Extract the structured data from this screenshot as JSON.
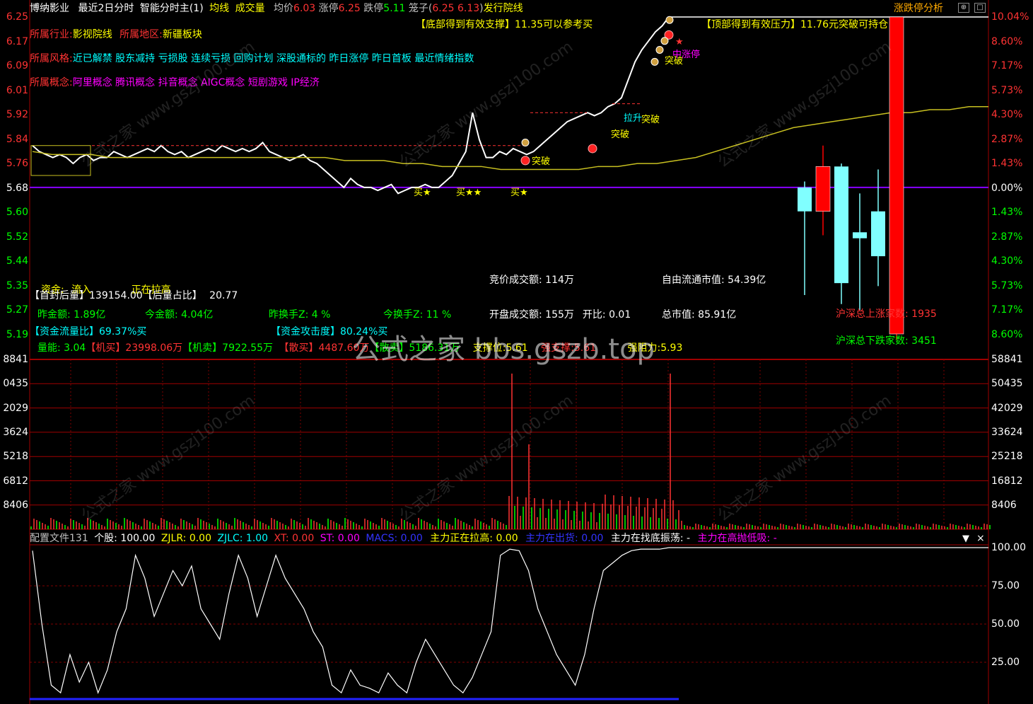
{
  "header": {
    "stock_name": "博纳影业",
    "mode": "最近2日分时",
    "indicator": "智能分时主(1)",
    "avg_line_label": "均线",
    "volume_label": "成交量",
    "avg_price_label": "均价",
    "avg_price": "6.03",
    "limit_up_label": "涨停",
    "limit_up": "6.25",
    "limit_down_label": "跌停",
    "limit_down": "5.11",
    "cage_label": "笼子(",
    "cage_value": "6.25 6.13",
    "cage_close": ")",
    "industry_tag": "发行院线",
    "button_label": "涨跌停分析"
  },
  "info": {
    "industry_label": "所属行业:",
    "industry": "影视院线",
    "region_label": "所属地区:",
    "region": "新疆板块",
    "style_label": "所属风格:",
    "style": "近已解禁 股东减持 亏损股 连续亏损 回购计划 深股通标的 昨日涨停 昨日首板 最近情绪指数",
    "concept_label": "所属概念:",
    "concept": "阿里概念 腾讯概念 抖音概念 AIGC概念 短剧游戏 IP经济",
    "support_label": "【底部得到有效支撑】",
    "support_text": "11.35可以参考买",
    "resist_label": "【顶部得到有效压力】",
    "resist_text": "11.76元突破可持仓"
  },
  "annotations": {
    "buy": "买",
    "star": "★",
    "breakout": "突破",
    "pull_up": "拉升",
    "mid_limit": "中涨停",
    "flag": "$",
    "arrow": "↑"
  },
  "stats": {
    "fund_label": "资金:",
    "fund_value": "流入",
    "pulling_label": "正在拉高",
    "first_seal_label": "【首封后量】",
    "first_seal_value": "139154.00",
    "after_ratio_label": "【后量占比】",
    "after_ratio_value": "20.77",
    "yday_amount_label": "昨金额:",
    "yday_amount": "1.89亿",
    "today_amount_label": "今金额:",
    "today_amount": "4.04亿",
    "yday_turnover_label": "昨换手Z:",
    "yday_turnover": "4 %",
    "today_turnover_label": "今换手Z:",
    "today_turnover": "11 %",
    "flow_ratio_label": "【资金流量比】",
    "flow_ratio": "69.37",
    "flow_ratio_unit": "%买",
    "attack_label": "【资金攻击度】",
    "attack": "80.24",
    "attack_unit": "%买",
    "vol_energy_label": "量能:",
    "vol_energy": "3.04",
    "inst_buy_label": "【机买】",
    "inst_buy": "23998.06万",
    "inst_sell_label": "【机卖】",
    "inst_sell": "7922.55万",
    "retail_buy_label": "【散买】",
    "retail_buy": "4487.60万",
    "retail_sell_label": "【散卖】",
    "retail_sell": "5186.31万",
    "support_level_label": "支撑位:",
    "support_level": "5.61",
    "strong_support_label": "强支撑:",
    "strong_support": "5.61",
    "strong_resist_label": "强阻力:",
    "strong_resist": "5.93",
    "auction_amount_label": "竞价成交额:",
    "auction_amount": "114万",
    "open_amount_label": "开盘成交额:",
    "open_amount": "155万",
    "open_ratio_label": "开比:",
    "open_ratio": "0.01",
    "float_cap_label": "自由流通市值:",
    "float_cap": "54.39亿",
    "total_cap_label": "总市值:",
    "total_cap": "85.91亿",
    "market_up_label": "沪深总上涨家数:",
    "market_up": "1935",
    "market_down_label": "沪深总下跌家数:",
    "market_down": "3451"
  },
  "watermark": {
    "center": "公式之家 bbs.gszb.top",
    "tile": "公式之家 www.gszj100.com"
  },
  "lower_panel": {
    "config_label": "配置文件131",
    "stock_label": "个股:",
    "stock_value": "100.00",
    "zjlr_label": "ZJLR:",
    "zjlr": "0.00",
    "zjlc_label": "ZJLC:",
    "zjlc": "1.00",
    "xt_label": "XT:",
    "xt": "0.00",
    "st_label": "ST:",
    "st": "0.00",
    "macs_label": "MACS:",
    "macs": "0.00",
    "main_pull_label": "主力正在拉高:",
    "main_pull": "0.00",
    "main_out_label": "主力在出货:",
    "main_out": "0.00",
    "main_bottom_label": "主力在找底振荡:",
    "main_bottom": "-",
    "main_high_label": "主力在高抛低吸:",
    "main_high": "-",
    "dropdown_icon": "▼",
    "close_icon": "×"
  },
  "colors": {
    "up": "#ff3333",
    "down": "#00ff00",
    "price_line": "#ffffff",
    "avg_line": "#c8c020",
    "prev_close": "#8800ff",
    "candle_up": "#ff0000",
    "candle_down": "#80ffff",
    "grid": "#a00000"
  },
  "chart_data": [
    {
      "type": "line",
      "name": "intraday price",
      "y_left_ticks": [
        "6.25",
        "6.17",
        "6.09",
        "6.01",
        "5.92",
        "5.84",
        "5.76",
        "5.68",
        "5.60",
        "5.52",
        "5.44",
        "5.35",
        "5.27",
        "5.19"
      ],
      "y_right_ticks": [
        "10.04%",
        "8.60%",
        "7.17%",
        "5.73%",
        "4.30%",
        "2.87%",
        "1.43%",
        "0.00%",
        "1.43%",
        "2.87%",
        "4.30%",
        "5.73%",
        "7.17%",
        "8.60%"
      ],
      "prev_close": 5.68,
      "series": [
        {
          "name": "price",
          "values": [
            5.82,
            5.8,
            5.79,
            5.78,
            5.79,
            5.78,
            5.76,
            5.78,
            5.79,
            5.77,
            5.78,
            5.78,
            5.8,
            5.79,
            5.78,
            5.79,
            5.8,
            5.81,
            5.8,
            5.82,
            5.8,
            5.79,
            5.8,
            5.78,
            5.79,
            5.8,
            5.81,
            5.8,
            5.82,
            5.81,
            5.8,
            5.81,
            5.8,
            5.81,
            5.83,
            5.8,
            5.79,
            5.78,
            5.77,
            5.78,
            5.79,
            5.77,
            5.76,
            5.74,
            5.72,
            5.7,
            5.68,
            5.71,
            5.69,
            5.68,
            5.68,
            5.67,
            5.68,
            5.69,
            5.66,
            5.67,
            5.68,
            5.68,
            5.69,
            5.68,
            5.68,
            5.7,
            5.72,
            5.76,
            5.8,
            5.93,
            5.84,
            5.78,
            5.78,
            5.8,
            5.79,
            5.81,
            5.8,
            5.79,
            5.8,
            5.82,
            5.84,
            5.86,
            5.88,
            5.9,
            5.91,
            5.92,
            5.93,
            5.92,
            5.93,
            5.95,
            5.96,
            5.98,
            6.04,
            6.1,
            6.14,
            6.17,
            6.2,
            6.22,
            6.25
          ]
        },
        {
          "name": "avg",
          "values": [
            5.8,
            5.79,
            5.79,
            5.79,
            5.78,
            5.78,
            5.78,
            5.78,
            5.78,
            5.78,
            5.78,
            5.78,
            5.78,
            5.78,
            5.78,
            5.78,
            5.77,
            5.77,
            5.77,
            5.76,
            5.76,
            5.75,
            5.75,
            5.75,
            5.74,
            5.74,
            5.74,
            5.74,
            5.74,
            5.75,
            5.75,
            5.76,
            5.76,
            5.77,
            5.78,
            5.8,
            5.82,
            5.84,
            5.86,
            5.88,
            5.89,
            5.9,
            5.91,
            5.92,
            5.93,
            5.93,
            5.94,
            5.94,
            5.95,
            5.95
          ]
        }
      ]
    },
    {
      "type": "bar",
      "name": "daily candles",
      "candles": [
        {
          "open": 5.68,
          "close": 5.6,
          "high": 5.7,
          "low": 5.32,
          "up": false
        },
        {
          "open": 5.6,
          "close": 5.75,
          "high": 5.82,
          "low": 5.52,
          "up": true
        },
        {
          "open": 5.75,
          "close": 5.36,
          "high": 5.76,
          "low": 5.29,
          "up": false
        },
        {
          "open": 5.53,
          "close": 5.51,
          "high": 5.66,
          "low": 5.27,
          "up": false
        },
        {
          "open": 5.6,
          "close": 5.45,
          "high": 5.74,
          "low": 5.35,
          "up": false
        },
        {
          "open": 5.19,
          "close": 6.25,
          "high": 6.25,
          "low": 5.17,
          "up": true
        }
      ]
    },
    {
      "type": "bar",
      "name": "volume",
      "y_ticks": [
        "58841",
        "50435",
        "42029",
        "33624",
        "25218",
        "16812",
        "8406"
      ],
      "y_ticks_left": [
        "8841",
        "0435",
        "2029",
        "3624",
        "5218",
        "6812",
        "8406"
      ]
    },
    {
      "type": "line",
      "name": "oscillator",
      "y_ticks": [
        "100.00",
        "75.00",
        "50.00",
        "25.00"
      ],
      "ylim": [
        0,
        100
      ]
    }
  ]
}
